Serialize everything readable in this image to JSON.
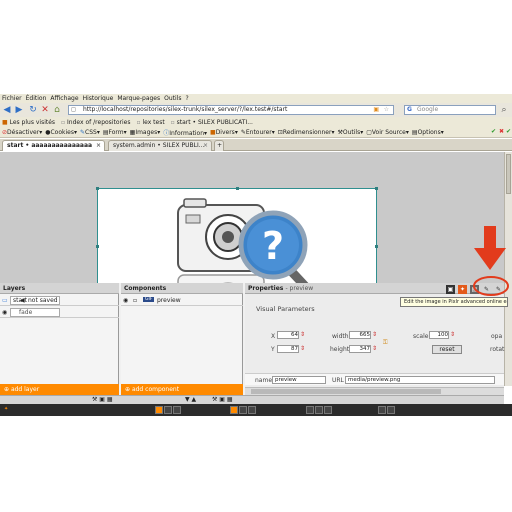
{
  "menu": [
    "Fichier",
    "Édition",
    "Affichage",
    "Historique",
    "Marque-pages",
    "Outils",
    "?"
  ],
  "nav": {
    "url": "http://localhost/repositories/silex-trunk/silex_server/?/lex.test#/start",
    "search_placeholder": "Google"
  },
  "bookmarks": [
    "Les plus visités",
    "Index of /repositories",
    "lex test",
    "start • SILEX PUBLICATI..."
  ],
  "devbar": [
    "Désactiver",
    "Cookies",
    "CSS",
    "Form",
    "Images",
    "Information",
    "Divers",
    "Entourer",
    "Redimensionner",
    "Outils",
    "Voir Source",
    "Options"
  ],
  "tabs": [
    "start • aaaaaaaaaaaaaaa",
    "system.admin • SILEX PUBLI..."
  ],
  "layers": {
    "title": "Layers",
    "items": [
      {
        "name": "start",
        "state": "not saved"
      },
      {
        "name": "",
        "state": "fade"
      }
    ],
    "add_label": "add layer"
  },
  "components": {
    "title": "Components",
    "items": [
      {
        "badge": "GIF",
        "name": "preview"
      }
    ],
    "add_label": "add component"
  },
  "properties": {
    "title": "Properties",
    "subtitle": "preview",
    "section": "Visual Parameters",
    "x": "64",
    "y": "87",
    "width": "665",
    "height": "347",
    "scale": "100",
    "reset_label": "reset",
    "opacity_label": "opa",
    "rotation_label": "rotat",
    "name_value": "preview",
    "url_value": "media/preview.png",
    "labels": {
      "x": "X",
      "y": "Y",
      "width": "width",
      "height": "height",
      "scale": "scale",
      "name": "name",
      "url": "URL"
    }
  },
  "tooltip": "Edit the image in Pixlr advanced online editor",
  "colors": {
    "accent": "#ff8a00",
    "annotation": "#e23b1c",
    "selection": "#2f8f8f"
  },
  "icons": {
    "camera": "camera-icon",
    "help": "magnifier-question-icon",
    "arrow": "red-arrow-down-icon"
  }
}
